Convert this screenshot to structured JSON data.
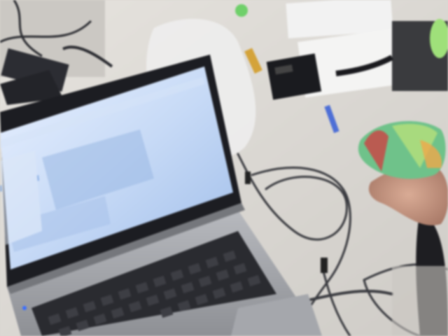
{
  "scene": {
    "colors": {
      "desk": "#d9d6d1",
      "desk_shadow": "#b9b6b1",
      "laptop_body": "#9c9ea3",
      "laptop_bezel": "#1c1d22",
      "screen_glow": "#bcd2f2",
      "screen_content": "#8fb0e0",
      "keyboard": "#2a2b30",
      "key": "#3b3c42",
      "cable": "#3a3b40",
      "hand": "#c89a86",
      "sleeve": "#1e1e22",
      "toy_green": "#6fc28a",
      "toy_red": "#c2504a"
    },
    "objects": [
      {
        "name": "laptop",
        "description_visible": false
      },
      {
        "name": "cables"
      },
      {
        "name": "hand-holding-colorful-toy"
      },
      {
        "name": "small-black-box"
      },
      {
        "name": "plastic-bag"
      },
      {
        "name": "green-cup"
      }
    ]
  }
}
